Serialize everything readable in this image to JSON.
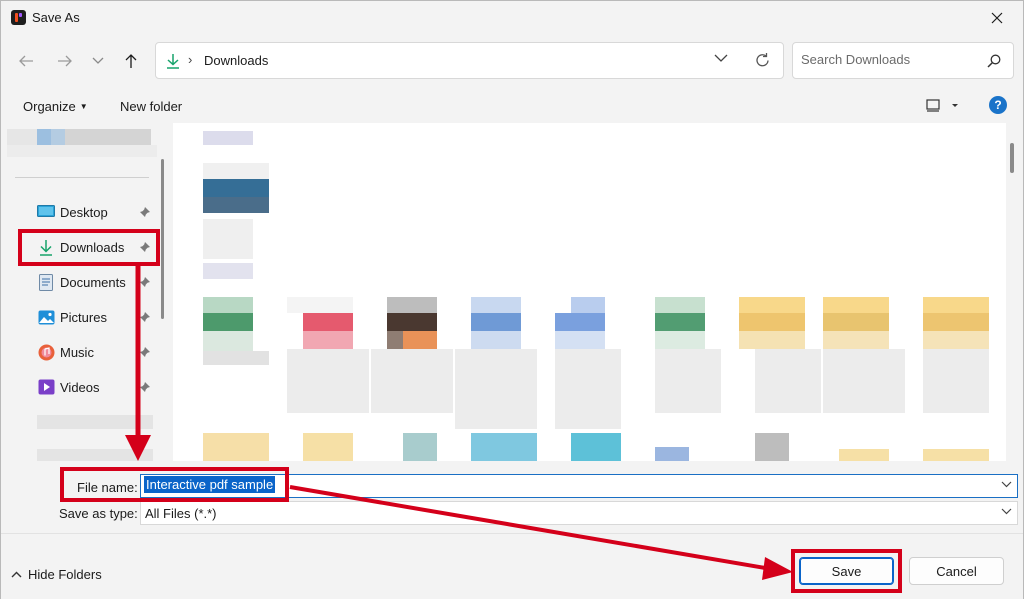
{
  "window": {
    "title": "Save As"
  },
  "address": {
    "location": "Downloads",
    "separator": "›"
  },
  "search": {
    "placeholder": "Search Downloads"
  },
  "toolbar": {
    "organize_label": "Organize",
    "new_folder_label": "New folder",
    "help_label": "?"
  },
  "sidebar": {
    "items": [
      {
        "label": "Desktop",
        "icon": "desktop-icon"
      },
      {
        "label": "Downloads",
        "icon": "download-icon"
      },
      {
        "label": "Documents",
        "icon": "document-icon"
      },
      {
        "label": "Pictures",
        "icon": "pictures-icon"
      },
      {
        "label": "Music",
        "icon": "music-icon"
      },
      {
        "label": "Videos",
        "icon": "videos-icon"
      }
    ]
  },
  "form": {
    "file_name_label": "File name:",
    "file_name_value": "Interactive pdf sample",
    "save_as_type_label": "Save as type:",
    "save_as_type_value": "All Files (*.*)"
  },
  "footer": {
    "hide_folders_label": "Hide Folders",
    "save_label": "Save",
    "cancel_label": "Cancel"
  },
  "colors": {
    "accent": "#0a64c9",
    "annotation": "#d4001a",
    "download_green": "#17a36b"
  }
}
